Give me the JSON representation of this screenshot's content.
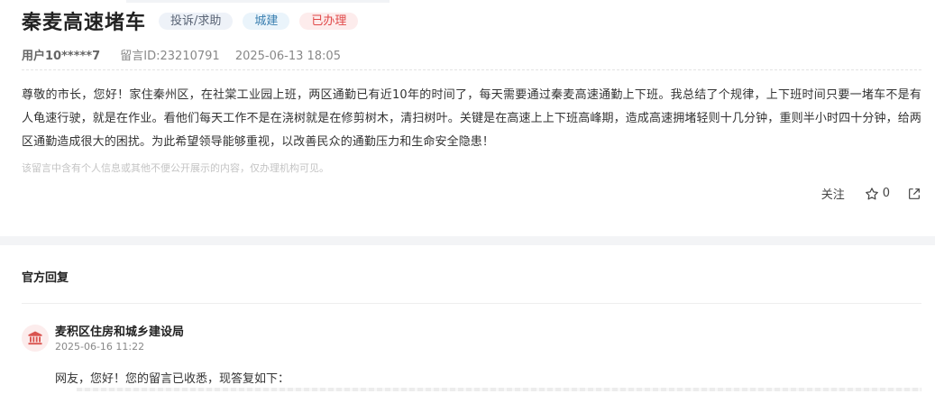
{
  "post": {
    "title": "秦麦高速堵车",
    "tags": {
      "category": "投诉/求助",
      "area": "城建",
      "status": "已办理"
    },
    "meta": {
      "user": "用户10*****7",
      "message_id": "留言ID:23210791",
      "datetime": "2025-06-13 18:05"
    },
    "content": "尊敬的市长，您好！家住秦州区，在社棠工业园上班，两区通勤已有近10年的时间了，每天需要通过秦麦高速通勤上下班。我总结了个规律，上下班时间只要一堵车不是有人龟速行驶，就是在作业。看他们每天工作不是在浇树就是在修剪树木，清扫树叶。关键是在高速上上下班高峰期，造成高速拥堵轻则十几分钟，重则半小时四十分钟，给两区通勤造成很大的困扰。为此希望领导能够重视，以改善民众的通勤压力和生命安全隐患！",
    "privacy_notice": "该留言中含有个人信息或其他不便公开展示的内容，仅办理机构可见。"
  },
  "actions": {
    "follow_label": "关注",
    "like_count": "0"
  },
  "reply": {
    "section_title": "官方回复",
    "department": "麦积区住房和城乡建设局",
    "datetime": "2025-06-16 11:22",
    "text": "网友，您好！您的留言已收悉，现答复如下："
  },
  "colors": {
    "status_red": "#e04848",
    "area_blue": "#3a7fb0",
    "avatar_red": "#d9534f"
  }
}
